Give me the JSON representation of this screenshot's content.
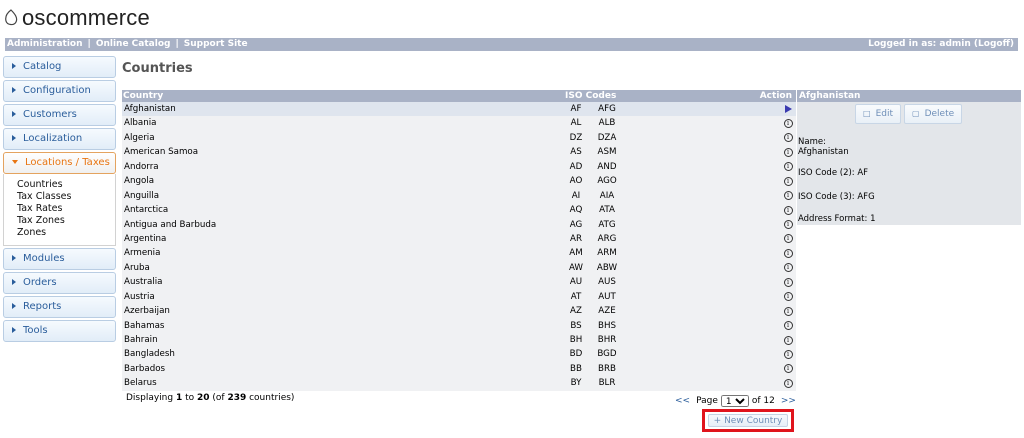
{
  "brand": {
    "name": "oscommerce"
  },
  "topbar": {
    "links": [
      "Administration",
      "Online Catalog",
      "Support Site"
    ],
    "separator": "|",
    "logged_in": "Logged in as: admin (Logoff)"
  },
  "sidebar": {
    "items": [
      {
        "label": "Catalog"
      },
      {
        "label": "Configuration"
      },
      {
        "label": "Customers"
      },
      {
        "label": "Localization"
      },
      {
        "label": "Locations / Taxes"
      },
      {
        "label": "Modules"
      },
      {
        "label": "Orders"
      },
      {
        "label": "Reports"
      },
      {
        "label": "Tools"
      }
    ],
    "sub_items": [
      "Countries",
      "Tax Classes",
      "Tax Rates",
      "Tax Zones",
      "Zones"
    ]
  },
  "page": {
    "title": "Countries"
  },
  "table": {
    "headers": {
      "country": "Country",
      "iso": "ISO Codes",
      "action": "Action"
    },
    "rows": [
      {
        "country": "Afghanistan",
        "iso2": "AF",
        "iso3": "AFG"
      },
      {
        "country": "Albania",
        "iso2": "AL",
        "iso3": "ALB"
      },
      {
        "country": "Algeria",
        "iso2": "DZ",
        "iso3": "DZA"
      },
      {
        "country": "American Samoa",
        "iso2": "AS",
        "iso3": "ASM"
      },
      {
        "country": "Andorra",
        "iso2": "AD",
        "iso3": "AND"
      },
      {
        "country": "Angola",
        "iso2": "AO",
        "iso3": "AGO"
      },
      {
        "country": "Anguilla",
        "iso2": "AI",
        "iso3": "AIA"
      },
      {
        "country": "Antarctica",
        "iso2": "AQ",
        "iso3": "ATA"
      },
      {
        "country": "Antigua and Barbuda",
        "iso2": "AG",
        "iso3": "ATG"
      },
      {
        "country": "Argentina",
        "iso2": "AR",
        "iso3": "ARG"
      },
      {
        "country": "Armenia",
        "iso2": "AM",
        "iso3": "ARM"
      },
      {
        "country": "Aruba",
        "iso2": "AW",
        "iso3": "ABW"
      },
      {
        "country": "Australia",
        "iso2": "AU",
        "iso3": "AUS"
      },
      {
        "country": "Austria",
        "iso2": "AT",
        "iso3": "AUT"
      },
      {
        "country": "Azerbaijan",
        "iso2": "AZ",
        "iso3": "AZE"
      },
      {
        "country": "Bahamas",
        "iso2": "BS",
        "iso3": "BHS"
      },
      {
        "country": "Bahrain",
        "iso2": "BH",
        "iso3": "BHR"
      },
      {
        "country": "Bangladesh",
        "iso2": "BD",
        "iso3": "BGD"
      },
      {
        "country": "Barbados",
        "iso2": "BB",
        "iso3": "BRB"
      },
      {
        "country": "Belarus",
        "iso2": "BY",
        "iso3": "BLR"
      }
    ],
    "selected_country": "Afghanistan",
    "icons": {
      "selected": "play-icon",
      "other": "info-icon"
    }
  },
  "footer": {
    "displaying_prefix": "Displaying ",
    "from": "1",
    "to_word": " to ",
    "to": "20",
    "of_open": " (of ",
    "total": "239",
    "of_close": " countries)"
  },
  "pager": {
    "prev": "<<",
    "page_label": "Page",
    "current": "1",
    "of_label": "of 12",
    "next": ">>"
  },
  "new_country_button": {
    "label": "New Country",
    "icon": "plus-icon"
  },
  "right_panel": {
    "title": "Afghanistan",
    "edit_label": "Edit",
    "delete_label": "Delete",
    "name_label": "Name:",
    "name_value": "Afghanistan",
    "iso2_line": "ISO Code (2): AF",
    "iso3_line": "ISO Code (3): AFG",
    "address_format_line": "Address Format: 1"
  },
  "colors": {
    "header_bar": "#a9b2c6",
    "sidebar_text": "#2a5d9b",
    "active_accent": "#e87512",
    "highlight_box": "#e0141c"
  }
}
